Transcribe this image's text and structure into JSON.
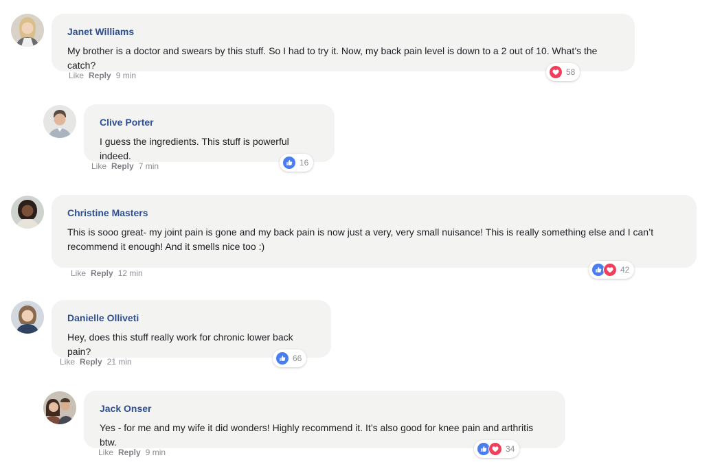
{
  "comments": [
    {
      "name": "Janet Williams",
      "text": "My brother is a doctor and swears by this stuff. So I had to try it. Now, my back pain level is down to a 2 out of 10. What’s the catch?",
      "like": "Like",
      "reply": "Reply",
      "time": "9 min",
      "reactions": [
        "love"
      ],
      "count": "58",
      "avatar_icon": "woman-avatar"
    },
    {
      "name": "Clive Porter",
      "text": "I guess the ingredients. This stuff is powerful indeed.",
      "like": "Like",
      "reply": "Reply",
      "time": "7 min",
      "reactions": [
        "like"
      ],
      "count": "16",
      "avatar_icon": "man-avatar"
    },
    {
      "name": "Christine Masters",
      "text": "This is sooo great- my joint pain is gone and my back pain is now just a very, very small nuisance! This is really something else and I can’t recommend it enough! And it smells nice too :)",
      "like": "Like",
      "reply": "Reply",
      "time": "12 min",
      "reactions": [
        "like",
        "love"
      ],
      "count": "42",
      "avatar_icon": "woman-avatar"
    },
    {
      "name": "Danielle Olliveti",
      "text": "Hey, does this stuff really work for chronic lower back pain?",
      "like": "Like",
      "reply": "Reply",
      "time": "21 min",
      "reactions": [
        "like"
      ],
      "count": "66",
      "avatar_icon": "woman-avatar"
    },
    {
      "name": "Jack Onser",
      "text": "Yes - for me and my wife it did wonders! Highly recommend it. It’s also good for knee pain and arthritis btw.",
      "like": "Like",
      "reply": "Reply",
      "time": "9 min",
      "reactions": [
        "like",
        "love"
      ],
      "count": "34",
      "avatar_icon": "couple-avatar"
    }
  ],
  "colors": {
    "name": "#2f4f8f",
    "bubble": "#f3f3f2",
    "like": "#4a7ef0",
    "love": "#f0405c",
    "meta": "#8a8d91"
  }
}
